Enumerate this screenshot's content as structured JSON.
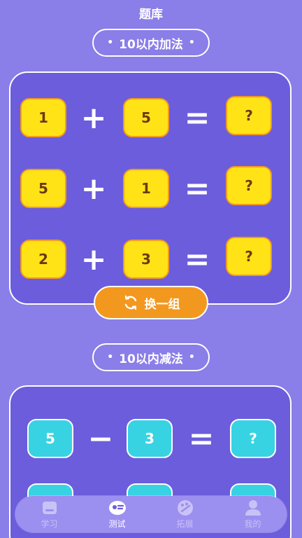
{
  "header": {
    "title": "题库"
  },
  "addition": {
    "title": "10以内加法",
    "rows": [
      {
        "a": "1",
        "op": "+",
        "b": "5",
        "eq": "=",
        "answer": "?"
      },
      {
        "a": "5",
        "op": "+",
        "b": "1",
        "eq": "=",
        "answer": "?"
      },
      {
        "a": "2",
        "op": "+",
        "b": "3",
        "eq": "=",
        "answer": "?"
      }
    ],
    "swap_label": "换一组"
  },
  "subtraction": {
    "title": "10以内减法",
    "rows": [
      {
        "a": "5",
        "op": "−",
        "b": "3",
        "eq": "=",
        "answer": "?"
      }
    ]
  },
  "colors": {
    "background": "#8a7ee8",
    "panel": "#6b5ddc",
    "yellow_tile": "#ffe316",
    "cyan_tile": "#37d3e3",
    "swap_button": "#f3981f"
  },
  "tabbar": {
    "items": [
      {
        "label": "学习",
        "icon": "home-icon",
        "active": false
      },
      {
        "label": "测试",
        "icon": "quiz-icon",
        "active": true
      },
      {
        "label": "拓展",
        "icon": "palette-icon",
        "active": false
      },
      {
        "label": "我的",
        "icon": "user-icon",
        "active": false
      }
    ]
  }
}
